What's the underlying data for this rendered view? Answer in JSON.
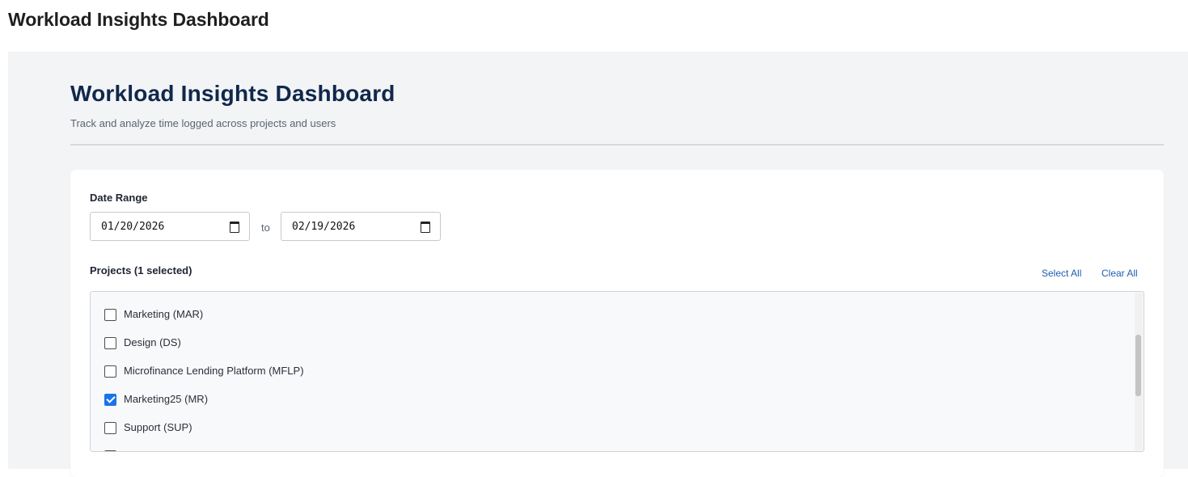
{
  "page": {
    "title": "Workload Insights Dashboard"
  },
  "dashboard": {
    "title": "Workload Insights Dashboard",
    "subtitle": "Track and analyze time logged across projects and users"
  },
  "filters": {
    "date_range": {
      "label": "Date Range",
      "start": "01/20/2026",
      "separator": "to",
      "end": "02/19/2026"
    },
    "projects": {
      "label": "Projects (1 selected)",
      "select_all": "Select All",
      "clear_all": "Clear All",
      "items": [
        {
          "label": "Marketing (MAR)",
          "checked": false
        },
        {
          "label": "Design (DS)",
          "checked": false
        },
        {
          "label": "Microfinance Lending Platform (MFLP)",
          "checked": false
        },
        {
          "label": "Marketing25 (MR)",
          "checked": true
        },
        {
          "label": "Support (SUP)",
          "checked": false
        }
      ]
    }
  },
  "colors": {
    "title": "#10284b",
    "link": "#1d5fb0",
    "checkbox_checked": "#1a73e8",
    "frame_bg": "#f3f4f6"
  }
}
